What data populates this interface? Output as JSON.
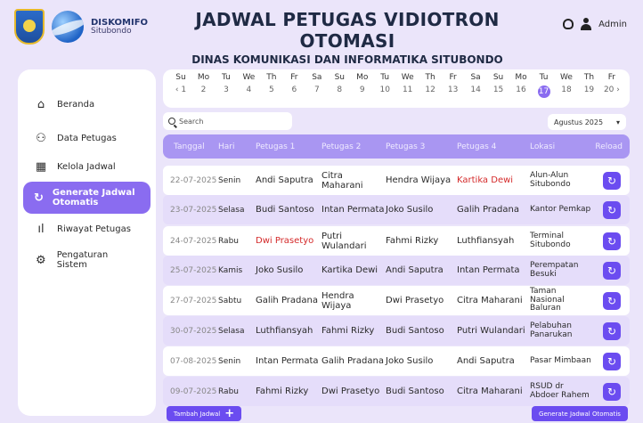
{
  "brand": {
    "name": "DISKOMIFO",
    "sub": "Situbondo"
  },
  "header": {
    "title": "JADWAL PETUGAS VIDIOTRON OTOMASI",
    "subtitle": "DINAS KOMUNIKASI DAN INFORMATIKA SITUBONDO",
    "user": "Admin"
  },
  "sidebar": {
    "items": [
      {
        "label": "Beranda",
        "icon": "home-icon",
        "active": false
      },
      {
        "label": "Data Petugas",
        "icon": "users-icon",
        "active": false
      },
      {
        "label": "Kelola Jadwal",
        "icon": "calendar-icon",
        "active": false
      },
      {
        "label": "Generate Jadwal Otomatis",
        "icon": "refresh-icon",
        "active": true
      },
      {
        "label": "Riwayat Petugas",
        "icon": "chart-icon",
        "active": false
      },
      {
        "label": "Pengaturan Sistem",
        "icon": "gear-icon",
        "active": false
      }
    ]
  },
  "calendar": {
    "days": [
      "Su",
      "Mo",
      "Tu",
      "We",
      "Th",
      "Fr",
      "Sa",
      "Su",
      "Mo",
      "Tu",
      "We",
      "Th",
      "Fr",
      "Sa",
      "Su",
      "Mo",
      "Tu",
      "We",
      "Th",
      "Fr"
    ],
    "dates": [
      "‹ 1",
      "2",
      "3",
      "4",
      "5",
      "6",
      "7",
      "8",
      "9",
      "10",
      "11",
      "12",
      "13",
      "14",
      "15",
      "16",
      "17",
      "18",
      "19",
      "20 ›"
    ],
    "selected": "17"
  },
  "search": {
    "placeholder": "Search"
  },
  "month": {
    "value": "Agustus 2025"
  },
  "table": {
    "headers": [
      "Tanggal",
      "Hari",
      "Petugas 1",
      "Petugas 2",
      "Petugas 3",
      "Petugas 4",
      "Lokasi",
      "Reload"
    ],
    "rows": [
      {
        "date": "22-07-2025",
        "day": "Senin",
        "p1": "Andi Saputra",
        "p2": "Citra Maharani",
        "p3": "Hendra Wijaya",
        "p4": "Kartika Dewi",
        "loc": "Alun-Alun Situbondo",
        "red": "p4"
      },
      {
        "date": "23-07-2025",
        "day": "Selasa",
        "p1": "Budi Santoso",
        "p2": "Intan Permata",
        "p3": "Joko Susilo",
        "p4": "Galih Pradana",
        "loc": "Kantor Pemkap",
        "red": ""
      },
      {
        "date": "24-07-2025",
        "day": "Rabu",
        "p1": "Dwi Prasetyo",
        "p2": "Putri Wulandari",
        "p3": "Fahmi Rizky",
        "p4": "Luthfiansyah",
        "loc": "Terminal Situbondo",
        "red": "p1"
      },
      {
        "date": "25-07-2025",
        "day": "Kamis",
        "p1": "Joko Susilo",
        "p2": "Kartika Dewi",
        "p3": "Andi Saputra",
        "p4": "Intan Permata",
        "loc": "Perempatan Besuki",
        "red": ""
      },
      {
        "date": "27-07-2025",
        "day": "Sabtu",
        "p1": "Galih Pradana",
        "p2": "Hendra Wijaya",
        "p3": "Dwi Prasetyo",
        "p4": "Citra Maharani",
        "loc": "Taman Nasional Baluran",
        "red": ""
      },
      {
        "date": "30-07-2025",
        "day": "Selasa",
        "p1": "Luthfiansyah",
        "p2": "Fahmi Rizky",
        "p3": "Budi Santoso",
        "p4": "Putri Wulandari",
        "loc": "Pelabuhan Panarukan",
        "red": ""
      },
      {
        "date": "07-08-2025",
        "day": "Senin",
        "p1": "Intan Permata",
        "p2": "Galih Pradana",
        "p3": "Joko Susilo",
        "p4": "Andi Saputra",
        "loc": "Pasar Mimbaan",
        "red": ""
      },
      {
        "date": "09-07-2025",
        "day": "Rabu",
        "p1": "Fahmi Rizky",
        "p2": "Dwi Prasetyo",
        "p3": "Budi Santoso",
        "p4": "Citra Maharani",
        "loc": "RSUD dr Abdoer Rahem",
        "red": ""
      }
    ]
  },
  "buttons": {
    "add": "Tambah Jadwal",
    "generate": "Generate Jadwal Otomatis"
  },
  "colors": {
    "accent": "#6b4cf0",
    "header": "#a996f2",
    "alt_row": "#e5ddfa",
    "warning_text": "#d42a2a"
  }
}
